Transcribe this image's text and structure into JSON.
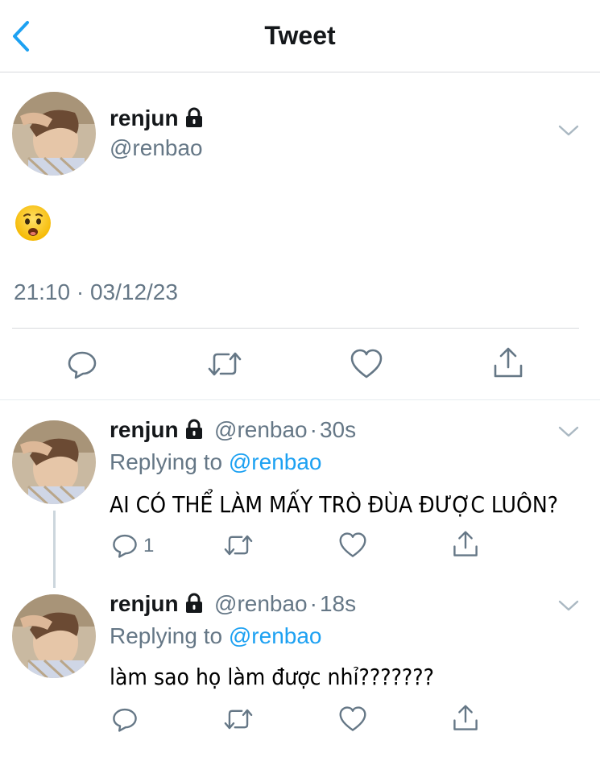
{
  "header": {
    "title": "Tweet"
  },
  "main_tweet": {
    "name": "renjun",
    "handle": "@renbao",
    "emoji": "😧",
    "timestamp": "21:10 · 03/12/23"
  },
  "replies": [
    {
      "name": "renjun",
      "handle": "@renbao",
      "dot": "·",
      "time": "30s",
      "replying_prefix": "Replying to",
      "replying_handle": "@renbao",
      "text": "AI CÓ THỂ LÀM MẤY TRÒ ĐÙA ĐƯỢC LUÔN?",
      "reply_count": "1"
    },
    {
      "name": "renjun",
      "handle": "@renbao",
      "dot": "·",
      "time": "18s",
      "replying_prefix": "Replying to",
      "replying_handle": "@renbao",
      "text": "làm sao họ làm được nhỉ???????"
    }
  ],
  "icons": {
    "back": "chevron-left-icon",
    "lock": "lock-icon",
    "caret": "chevron-down-icon",
    "reply": "reply-icon",
    "retweet": "retweet-icon",
    "like": "heart-icon",
    "share": "share-icon"
  },
  "colors": {
    "accent": "#1da1f2",
    "secondary_text": "#657786",
    "divider": "#d7dadd"
  }
}
